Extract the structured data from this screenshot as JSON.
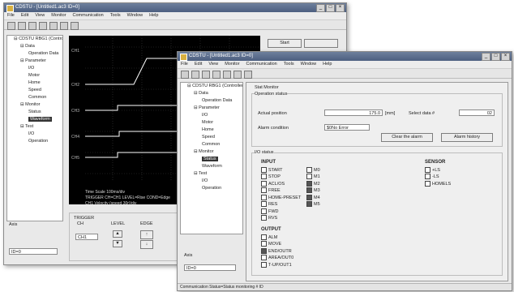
{
  "back": {
    "title": "CDSTU - [Untitled1.ac3 ID=0]",
    "menu": [
      "File",
      "Edit",
      "View",
      "Monitor",
      "Communication",
      "Tools",
      "Window",
      "Help"
    ],
    "tree": [
      {
        "t": "CDSTU RBG1 (Controller)",
        "l": 1
      },
      {
        "t": "Data",
        "l": 2
      },
      {
        "t": "Operation Data",
        "l": 3
      },
      {
        "t": "Parameter",
        "l": 2
      },
      {
        "t": "I/O",
        "l": 3
      },
      {
        "t": "Motor",
        "l": 3
      },
      {
        "t": "Home",
        "l": 3
      },
      {
        "t": "Speed",
        "l": 3
      },
      {
        "t": "Common",
        "l": 3
      },
      {
        "t": "Monitor",
        "l": 2
      },
      {
        "t": "Status",
        "l": 3
      },
      {
        "t": "Waveform",
        "l": 3,
        "sel": true
      },
      {
        "t": "Test",
        "l": 2
      },
      {
        "t": "I/O",
        "l": 3
      },
      {
        "t": "Operation",
        "l": 3
      }
    ],
    "start_button": "Start",
    "stop_button": "",
    "wave_footer": [
      "Time Scale 100ms/div",
      "TRIGGER CH=CH1 LEVEL=Rise COND=Edge",
      "CH1 Velocity (speed 30r)/div"
    ],
    "trigger_label": "TRIGGER",
    "ch_label": "CH",
    "level_label": "LEVEL",
    "edge_label": "EDGE",
    "ch_value": "CH1",
    "axis_label": "Axis",
    "axis_value": "ID=0"
  },
  "front": {
    "title": "CDSTU - [Untitled1.ac3 ID=0]",
    "menu": [
      "File",
      "Edit",
      "View",
      "Monitor",
      "Communication",
      "Tools",
      "Window",
      "Help"
    ],
    "tree": [
      {
        "t": "CDSTU RBG1 (Controller)",
        "l": 1
      },
      {
        "t": "Data",
        "l": 2
      },
      {
        "t": "Operation Data",
        "l": 3
      },
      {
        "t": "Parameter",
        "l": 2
      },
      {
        "t": "I/O",
        "l": 3
      },
      {
        "t": "Motor",
        "l": 3
      },
      {
        "t": "Home",
        "l": 3
      },
      {
        "t": "Speed",
        "l": 3
      },
      {
        "t": "Common",
        "l": 3
      },
      {
        "t": "Monitor",
        "l": 2
      },
      {
        "t": "Status",
        "l": 3,
        "sel": true
      },
      {
        "t": "Waveform",
        "l": 3
      },
      {
        "t": "Test",
        "l": 2
      },
      {
        "t": "I/O",
        "l": 3
      },
      {
        "t": "Operation",
        "l": 3
      }
    ],
    "panel_title": "Stat Monitor",
    "operation_status": "Operation status",
    "actual_position_label": "Actual position",
    "actual_position_value": "175.0",
    "actual_position_unit": "[mm]",
    "select_data_label": "Select data #",
    "select_data_value": "02",
    "alarm_label": "Alarm condition",
    "alarm_value": "$0No Error",
    "clear_alarm": "Clear the alarm",
    "alarm_history": "Alarm history",
    "io_status": "I/O status",
    "input_header": "INPUT",
    "inputs": [
      {
        "t": "START",
        "on": false
      },
      {
        "t": "STOP",
        "on": false
      },
      {
        "t": "ACL/OS",
        "on": false
      },
      {
        "t": "FREE",
        "on": false
      },
      {
        "t": "HOME-PRESET",
        "on": false
      },
      {
        "t": "RES",
        "on": false
      },
      {
        "t": "FWD",
        "on": false
      },
      {
        "t": "RVS",
        "on": false
      }
    ],
    "m_inputs": [
      {
        "t": "M0",
        "on": false
      },
      {
        "t": "M1",
        "on": false
      },
      {
        "t": "M2",
        "on": true
      },
      {
        "t": "M3",
        "on": true
      },
      {
        "t": "M4",
        "on": true
      },
      {
        "t": "M5",
        "on": true
      }
    ],
    "sensor_header": "SENSOR",
    "sensors": [
      {
        "t": "+LS",
        "on": false
      },
      {
        "t": "-LS",
        "on": false
      },
      {
        "t": "HOMELS",
        "on": false
      }
    ],
    "output_header": "OUTPUT",
    "outputs": [
      {
        "t": "ALM",
        "on": false
      },
      {
        "t": "MOVE",
        "on": false
      },
      {
        "t": "END/OUTR",
        "on": true
      },
      {
        "t": "AREA/OUT0",
        "on": false
      },
      {
        "t": "T-UP/OUT1",
        "on": false
      }
    ],
    "axis_label": "Axis",
    "axis_value": "ID=0",
    "status_bar": "Communication Status=Status monitoring # ID"
  },
  "colors": {
    "titlebar": "#4c5f80",
    "wave_bg": "#000000",
    "trace": "#ffffff"
  }
}
